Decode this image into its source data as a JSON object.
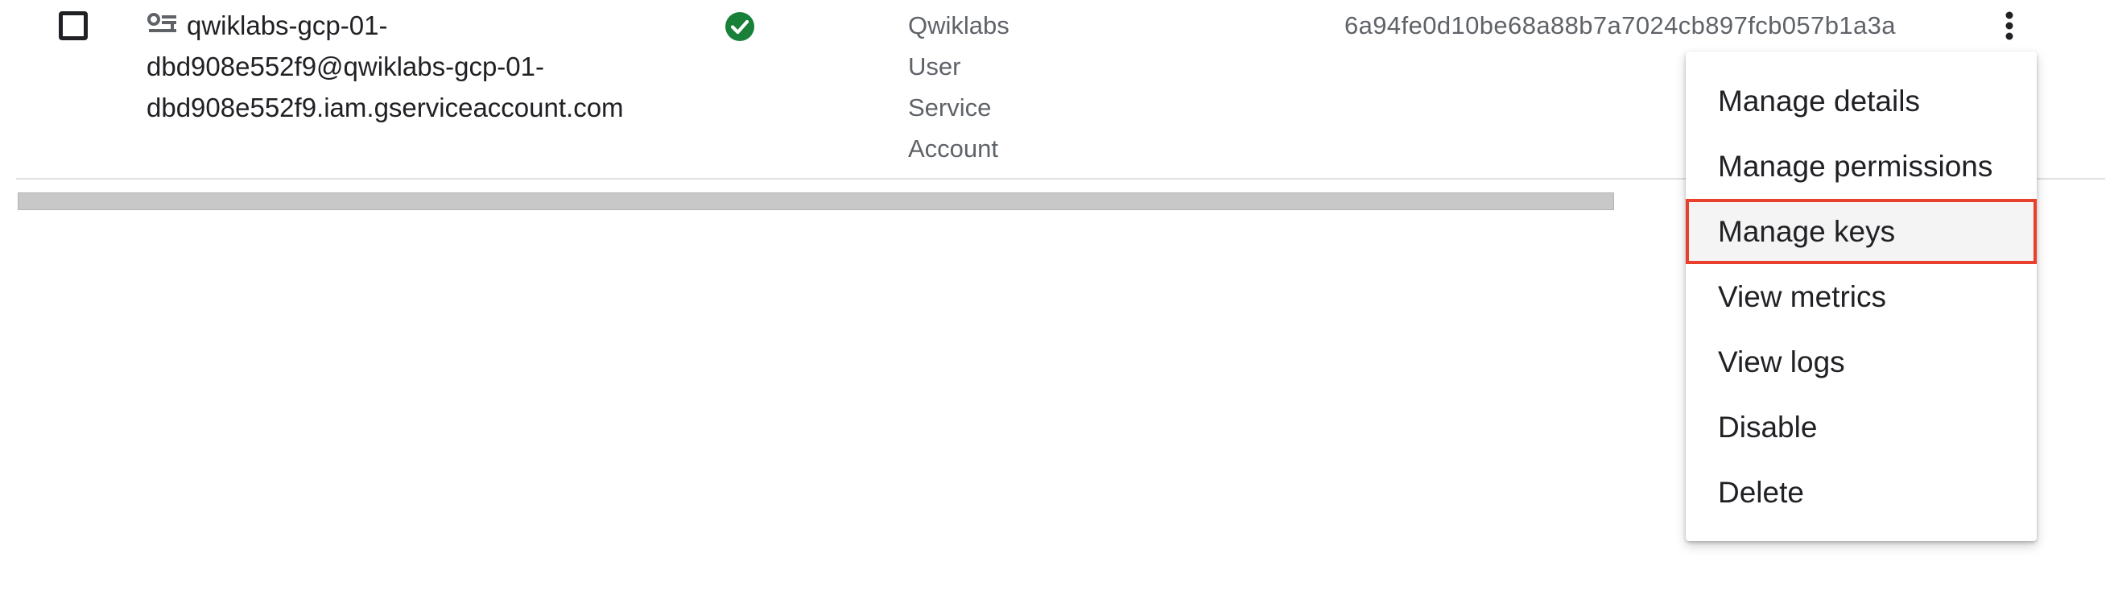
{
  "row": {
    "email_lines": [
      "qwiklabs-gcp-01-",
      "dbd908e552f9@qwiklabs-gcp-01-",
      "dbd908e552f9.iam.gserviceaccount.com"
    ],
    "status": "enabled",
    "name_lines": [
      "Qwiklabs",
      "User",
      "Service",
      "Account"
    ],
    "key_id": "6a94fe0d10be68a88b7a7024cb897fcb057b1a3a"
  },
  "menu": {
    "items": [
      {
        "label": "Manage details"
      },
      {
        "label": "Manage permissions"
      },
      {
        "label": "Manage keys",
        "highlighted": true
      },
      {
        "label": "View metrics"
      },
      {
        "label": "View logs"
      },
      {
        "label": "Disable"
      },
      {
        "label": "Delete"
      }
    ]
  },
  "icons": {
    "row_checkbox": "checkbox-unchecked-icon",
    "account_type": "service-account-key-icon",
    "status": "check-circle-icon",
    "actions": "more-vert-icon"
  },
  "colors": {
    "status_green": "#188038",
    "highlight_outline": "#e8402c",
    "text_primary": "#202124",
    "text_secondary": "#5f6368"
  }
}
